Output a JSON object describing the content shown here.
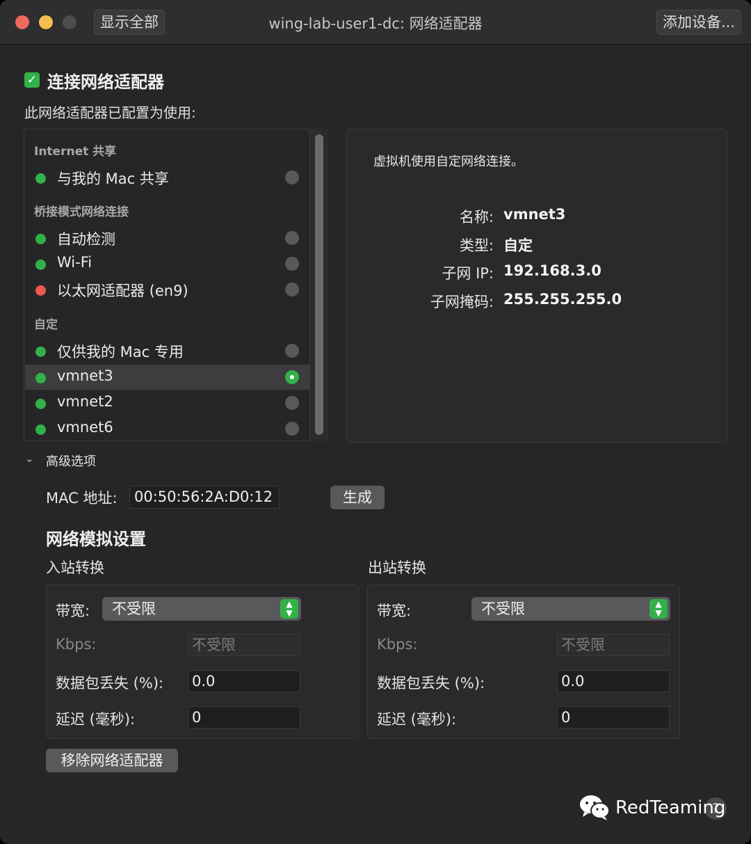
{
  "window": {
    "title": "wing-lab-user1-dc: 网络适配器",
    "show_all_label": "显示全部",
    "add_device_label": "添加设备..."
  },
  "adapter": {
    "enabled": true,
    "enable_label": "连接网络适配器",
    "configured_label": "此网络适配器已配置为使用:"
  },
  "groups": [
    {
      "header": "Internet 共享",
      "items": [
        {
          "label": "与我的 Mac 共享",
          "status": "green",
          "selected": false
        }
      ]
    },
    {
      "header": "桥接模式网络连接",
      "items": [
        {
          "label": "自动检测",
          "status": "green",
          "selected": false
        },
        {
          "label": "Wi-Fi",
          "status": "green",
          "selected": false
        },
        {
          "label": "以太网适配器 (en9)",
          "status": "red",
          "selected": false
        }
      ]
    },
    {
      "header": "自定",
      "items": [
        {
          "label": "仅供我的 Mac 专用",
          "status": "green",
          "selected": false
        },
        {
          "label": "vmnet3",
          "status": "green",
          "selected": true
        },
        {
          "label": "vmnet2",
          "status": "green",
          "selected": false
        },
        {
          "label": "vmnet6",
          "status": "green",
          "selected": false
        }
      ]
    }
  ],
  "info": {
    "description": "虚拟机使用自定网络连接。",
    "rows": [
      {
        "key": "名称:",
        "value": "vmnet3"
      },
      {
        "key": "类型:",
        "value": "自定"
      },
      {
        "key": "子网 IP:",
        "value": "192.168.3.0"
      },
      {
        "key": "子网掩码:",
        "value": "255.255.255.0"
      }
    ]
  },
  "advanced": {
    "label": "高级选项",
    "mac_label": "MAC 地址:",
    "mac_value": "00:50:56:2A:D0:12",
    "generate_label": "生成"
  },
  "simulation": {
    "title": "网络模拟设置",
    "inbound": {
      "label": "入站转换",
      "bandwidth_label": "带宽:",
      "bandwidth_value": "不受限",
      "kbps_label": "Kbps:",
      "kbps_placeholder": "不受限",
      "loss_label": "数据包丢失 (%):",
      "loss_value": "0.0",
      "latency_label": "延迟 (毫秒):",
      "latency_value": "0"
    },
    "outbound": {
      "label": "出站转换",
      "bandwidth_label": "带宽:",
      "bandwidth_value": "不受限",
      "kbps_label": "Kbps:",
      "kbps_placeholder": "不受限",
      "loss_label": "数据包丢失 (%):",
      "loss_value": "0.0",
      "latency_label": "延迟 (毫秒):",
      "latency_value": "0"
    }
  },
  "remove_label": "移除网络适配器",
  "watermark": {
    "text": "RedTeaming",
    "icon": "wechat-icon"
  },
  "help": {
    "label": "?"
  },
  "colors": {
    "green": "#32b14a",
    "red": "#ed5a4a",
    "accent": "#32b14a"
  }
}
